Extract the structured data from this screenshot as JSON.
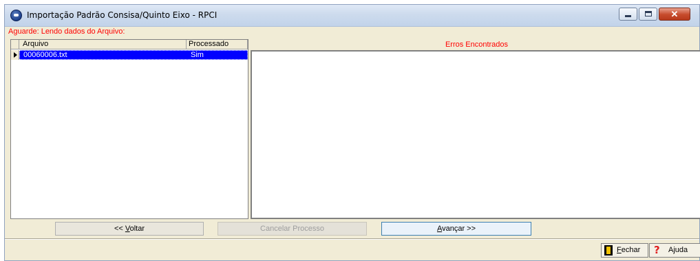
{
  "window": {
    "title": "Importação Padrão Consisa/Quinto Eixo - RPCI",
    "icon": "app-disc-icon"
  },
  "status": {
    "message": "Aguarde: Lendo dados do Arquivo:"
  },
  "files_grid": {
    "columns": [
      "Arquivo",
      "Processado"
    ],
    "rows": [
      {
        "arquivo": "00060006.txt",
        "processado": "Sim",
        "selected": true
      }
    ]
  },
  "errors": {
    "header": "Erros Encontrados"
  },
  "buttons": {
    "voltar_prefix": "<< ",
    "voltar_accel": "V",
    "voltar_rest": "oltar",
    "cancelar": "Cancelar Processo",
    "avancar_accel": "A",
    "avancar_rest": "vançar >>",
    "fechar_accel": "F",
    "fechar_rest": "echar",
    "ajuda": "Ajuda"
  },
  "colors": {
    "accent_status": "#ff0000",
    "selection": "#0000ff",
    "window_bg": "#f1ecd6"
  }
}
